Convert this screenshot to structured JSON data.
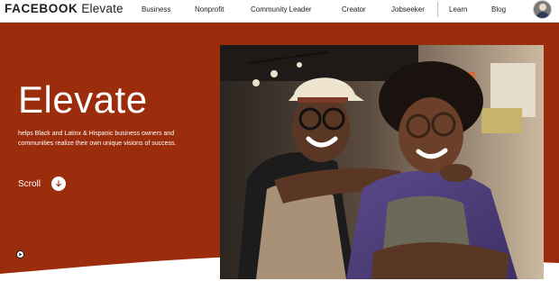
{
  "header": {
    "logo_brand": "FACEBOOK",
    "logo_product": "Elevate",
    "nav": [
      {
        "label": "Business"
      },
      {
        "label": "Nonprofit"
      },
      {
        "label": "Community Leader"
      },
      {
        "label": "Creator"
      },
      {
        "label": "Jobseeker"
      },
      {
        "label": "Learn"
      },
      {
        "label": "Blog"
      }
    ]
  },
  "hero": {
    "title": "Elevate",
    "subtitle": "helps Black and Latinx & Hispanic business owners and communities realize their own unique visions of success.",
    "scroll_label": "Scroll"
  },
  "colors": {
    "hero_background": "#9b2c0c",
    "text_on_hero": "#ffffff",
    "header_text": "#1c1e21"
  },
  "icons": {
    "scroll": "arrow-down-circle-icon",
    "play": "play-icon",
    "avatar": "user-avatar"
  }
}
